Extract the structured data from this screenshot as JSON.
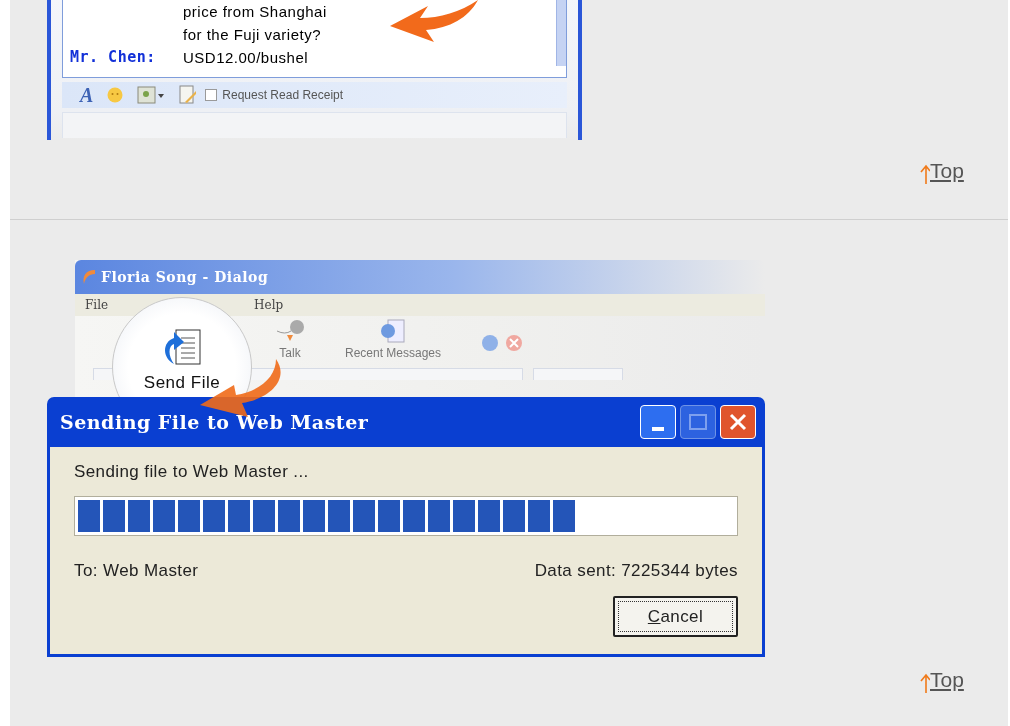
{
  "chat_excerpt": {
    "lines": [
      {
        "kind": "continuation",
        "text": "price from Shanghai"
      },
      {
        "kind": "continuation",
        "text": "for the Fuji variety?"
      },
      {
        "kind": "message",
        "sender": "Mr. Chen:",
        "text": "USD12.00/bushel"
      }
    ],
    "font_button": "A",
    "read_receipt": {
      "label": "Request Read Receipt",
      "checked": false
    }
  },
  "top_links": [
    {
      "label": "Top"
    },
    {
      "label": "Top"
    }
  ],
  "background_dialog": {
    "title": "Floria Song - Dialog",
    "menu": [
      "File",
      "Help"
    ],
    "toolbar": [
      {
        "kind": "magnified",
        "label": "Send File"
      },
      {
        "kind": "plain",
        "label": "Talk"
      },
      {
        "kind": "plain",
        "label": "Recent Messages"
      }
    ]
  },
  "send_dialog": {
    "title": "Sending File to Web Master",
    "status": "Sending file to Web Master ...",
    "level": 0.76,
    "recipient": "To: Web Master",
    "data_sent": "Data sent: 7225344 bytes",
    "buttons": [
      {
        "label": "Cancel",
        "focused": true
      }
    ]
  }
}
